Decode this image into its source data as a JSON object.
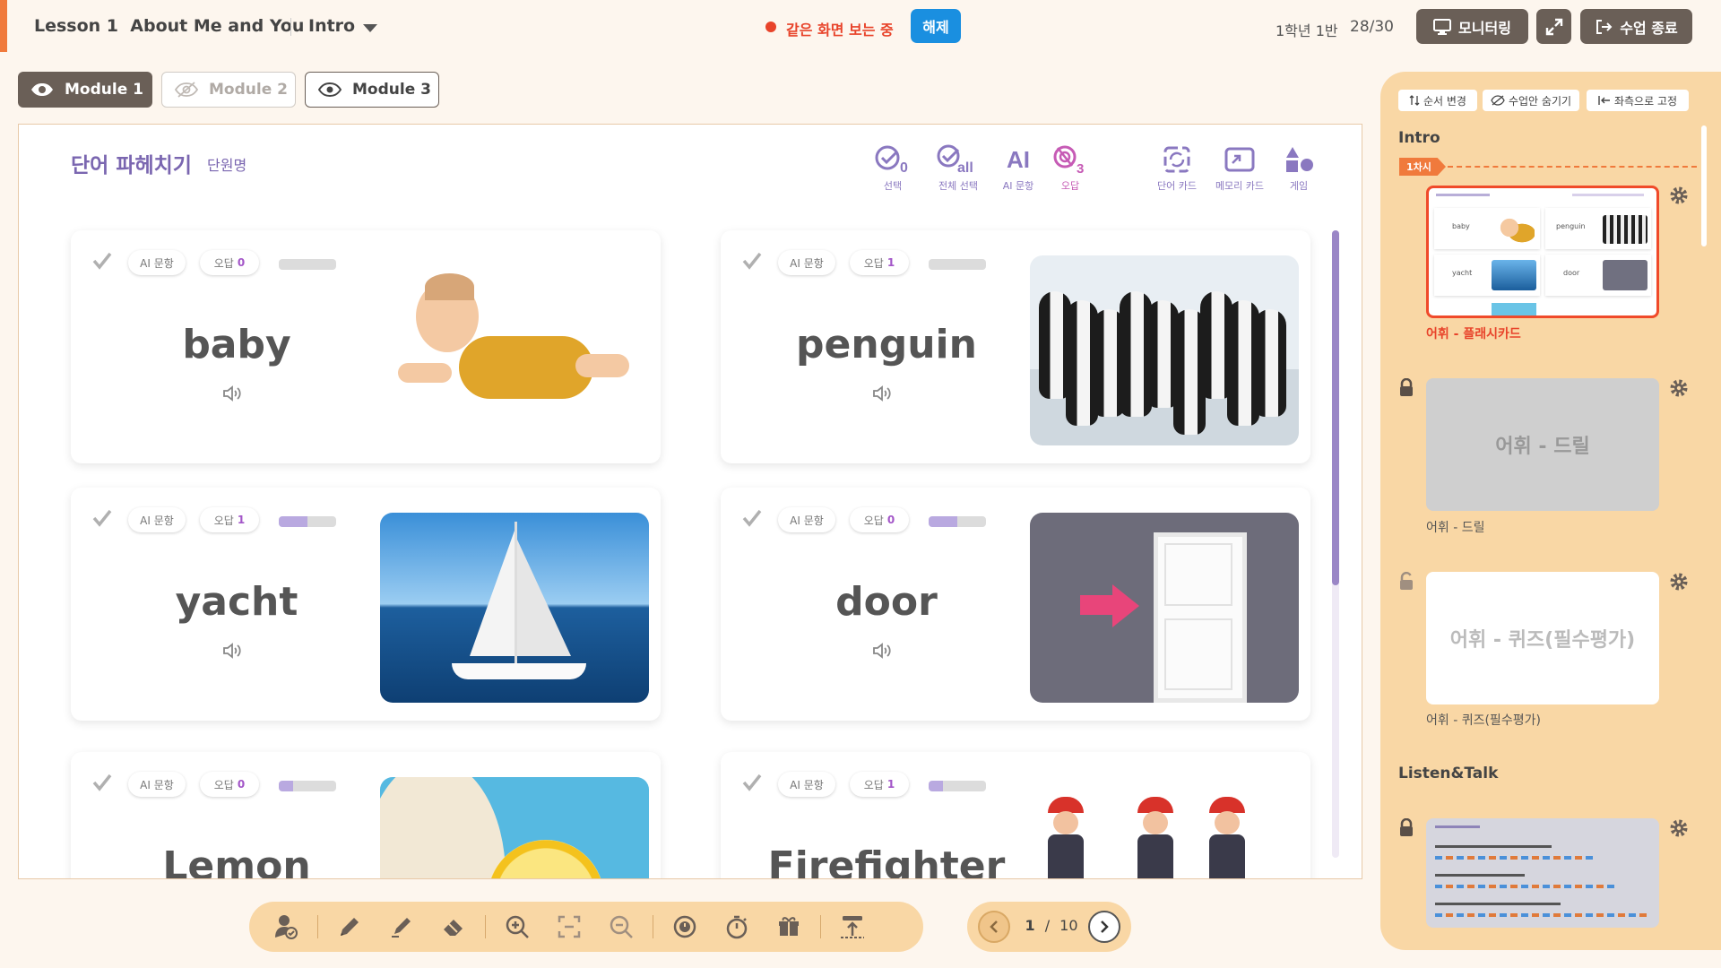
{
  "header": {
    "lesson_label": "Lesson 1",
    "lesson_title": "About Me and You",
    "section": "Intro",
    "live_status": "같은 화면 보는 중",
    "release_button": "해제",
    "class_name": "1학년 1반",
    "attendance": "28/30",
    "monitor_button": "모니터링",
    "end_button": "수업 종료"
  },
  "modules": [
    "Module 1",
    "Module 2",
    "Module 3"
  ],
  "main": {
    "title": "단어 파헤치기",
    "subtitle": "단원명",
    "tools": {
      "select": "선택",
      "select_all": "전체 선택",
      "ai": "AI 문항",
      "wrong": "오답",
      "word_card": "단어 카드",
      "memory_card": "메모리 카드",
      "game": "게임",
      "ai_glyph": "AI"
    },
    "cards": [
      {
        "word": "baby",
        "ai_label": "AI 문항",
        "wrong_label": "오답",
        "wrong_count": "0",
        "progress": 0.0,
        "image": "baby-photo"
      },
      {
        "word": "penguin",
        "ai_label": "AI 문항",
        "wrong_label": "오답",
        "wrong_count": "1",
        "progress": 0.0,
        "image": "penguins-photo"
      },
      {
        "word": "yacht",
        "ai_label": "AI 문항",
        "wrong_label": "오답",
        "wrong_count": "1",
        "progress": 0.5,
        "image": "sailboat-photo"
      },
      {
        "word": "door",
        "ai_label": "AI 문항",
        "wrong_label": "오답",
        "wrong_count": "0",
        "progress": 0.5,
        "image": "door-photo"
      },
      {
        "word": "Lemon",
        "ai_label": "AI 문항",
        "wrong_label": "오답",
        "wrong_count": "0",
        "progress": 0.25,
        "image": "lemon-photo"
      },
      {
        "word": "Firefighter",
        "ai_label": "AI 문항",
        "wrong_label": "오답",
        "wrong_count": "1",
        "progress": 0.25,
        "image": "firefighters-illustration"
      }
    ]
  },
  "pager": {
    "current": "1",
    "separator": "/",
    "total": "10"
  },
  "right_panel": {
    "buttons": [
      "순서 변경",
      "수업안 숨기기",
      "좌측으로 고정"
    ],
    "section_intro": "Intro",
    "session_flag": "1차시",
    "items": [
      {
        "label": "어휘 - 플래시카드",
        "thumb_text": ""
      },
      {
        "label": "어휘 - 드릴",
        "thumb_text": "어휘 - 드릴"
      },
      {
        "label": "어휘 - 퀴즈(필수평가)",
        "thumb_text": "어휘 - 퀴즈(필수평가)"
      }
    ],
    "section_listen": "Listen&Talk",
    "mini_thumb": {
      "penguin": "penguin",
      "baby": "baby",
      "yacht": "yacht",
      "door": "door"
    }
  },
  "colors": {
    "accent_purple": "#7a66b0",
    "orange": "#f07a3c",
    "panel_peach": "#f9d7a5",
    "dark_button": "#6a5f57",
    "blue_button": "#1a8fe0"
  }
}
